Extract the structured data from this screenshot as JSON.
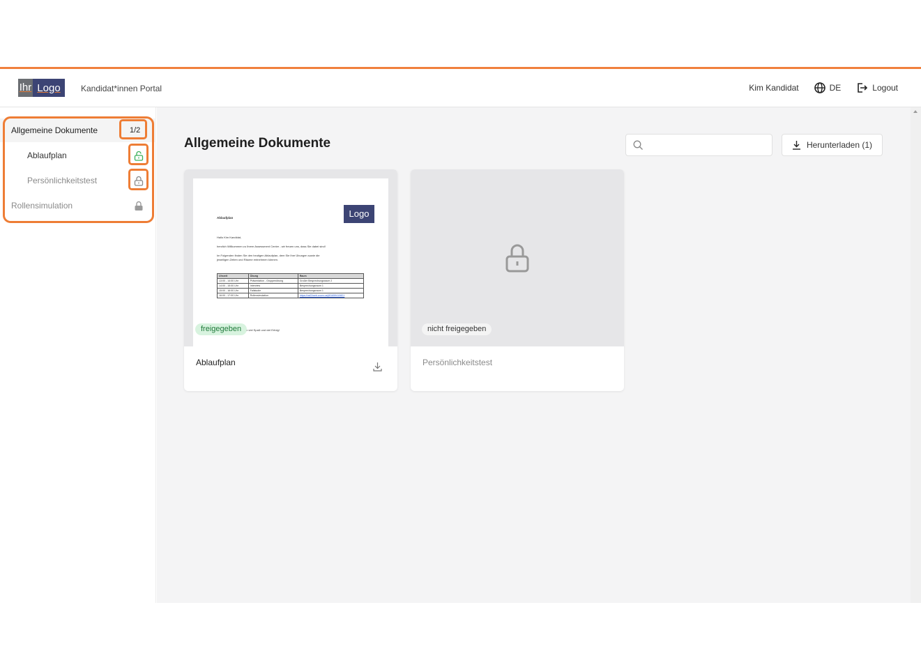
{
  "header": {
    "logo_left": "Ihr",
    "logo_right": "Logo",
    "portal_title": "Kandidat*innen Portal",
    "user_name": "Kim Kandidat",
    "language": "DE",
    "logout_label": "Logout"
  },
  "sidebar": {
    "root": {
      "label": "Allgemeine Dokumente",
      "count": "1/2"
    },
    "items": [
      {
        "label": "Ablaufplan",
        "status": "unlocked",
        "icon": "unlock-icon"
      },
      {
        "label": "Persönlichkeitstest",
        "status": "locked-outline",
        "icon": "lock-icon"
      }
    ],
    "sibling": {
      "label": "Rollensimulation",
      "status": "locked",
      "icon": "lock-icon"
    }
  },
  "main": {
    "title": "Allgemeine Dokumente",
    "search_placeholder": "",
    "download_label": "Herunterladen (1)"
  },
  "cards": [
    {
      "title": "Ablaufplan",
      "badge": "freigegeben",
      "badge_color": "#d8f3df",
      "preview": {
        "heading": "Ablaufplan",
        "logo_text": "Logo",
        "greeting": "Hallo Kim Kandidat,",
        "line1": "herzlich Willkommen zu Ihrem Assessment Center - wir freuen uns, dass Sie dabei sind!",
        "line2": "Im Folgenden finden Sie den heutigen Ablaufplan, dem Sie Ihre Übungen sowie die",
        "line3": "jeweiligen Zeiten und Räume entnehmen können.",
        "table_headers": [
          "Uhrzeit",
          "Übung",
          "Raum"
        ],
        "table_rows": [
          [
            "13:00 - 14:00 Uhr",
            "Präsentation - Gruppenübung",
            "Großer Besprechungsraum 2"
          ],
          [
            "14:00 - 15:00 Uhr",
            "Interview",
            "Besprechungsraum 1"
          ],
          [
            "15:00 - 16:00 Uhr",
            "Fallstudie",
            "Besprechungsraum 1"
          ],
          [
            "16:00 - 17:00 Uhr",
            "Rollensimulation",
            "https://us02web.zoom.us/j/81659410821"
          ]
        ],
        "closing": "en viel Spaß und viel Erfolg!"
      }
    },
    {
      "title": "Persönlichkeitstest",
      "badge": "nicht freigegeben",
      "badge_color": "#f4f4f4"
    }
  ],
  "colors": {
    "accent": "#f0803c",
    "unlocked_green": "#3bb05a",
    "locked_grey": "#9a9a9a"
  }
}
